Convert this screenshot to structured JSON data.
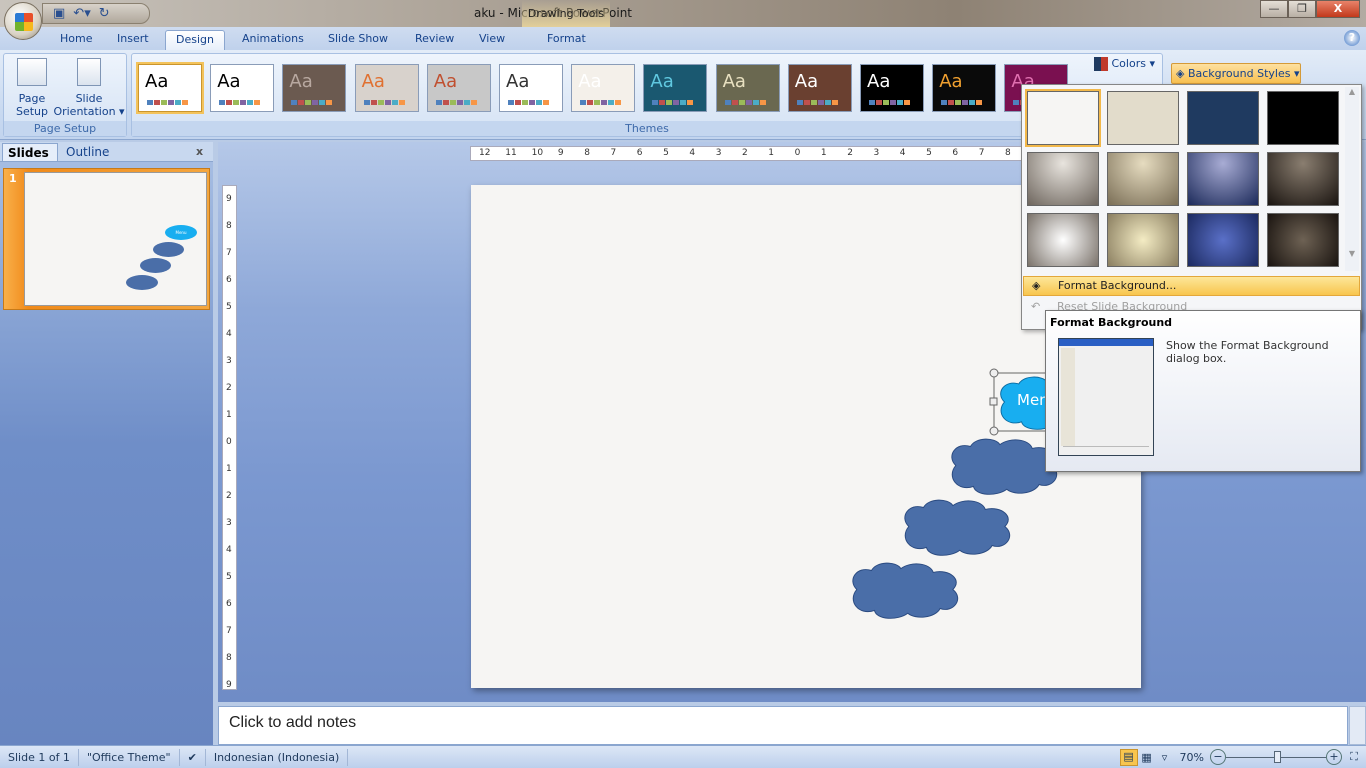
{
  "window": {
    "title": "aku - Microsoft PowerPoint",
    "context_tab_group": "Drawing Tools",
    "minimize": "—",
    "restore": "❐",
    "close": "X"
  },
  "qat": {
    "save_icon": "save-icon",
    "undo_icon": "undo-icon",
    "redo_icon": "redo-icon"
  },
  "tabs": [
    {
      "label": "Home"
    },
    {
      "label": "Insert"
    },
    {
      "label": "Design",
      "active": true
    },
    {
      "label": "Animations"
    },
    {
      "label": "Slide Show"
    },
    {
      "label": "Review"
    },
    {
      "label": "View"
    },
    {
      "label": "Format"
    }
  ],
  "ribbon": {
    "page_setup": {
      "label": "Page Setup",
      "page_setup_l1": "Page",
      "page_setup_l2": "Setup",
      "orient_l1": "Slide",
      "orient_l2": "Orientation ▾"
    },
    "themes": {
      "label": "Themes",
      "items": [
        {
          "bg": "#ffffff",
          "fg": "#000000"
        },
        {
          "bg": "#ffffff",
          "fg": "#000000"
        },
        {
          "bg": "#6b5a50",
          "fg": "#b8a8a0"
        },
        {
          "bg": "#d8d2cc",
          "fg": "#e07030"
        },
        {
          "bg": "#c8c8c8",
          "fg": "#c05030"
        },
        {
          "bg": "#ffffff",
          "fg": "#333333"
        },
        {
          "bg": "#f4f0ea",
          "fg": "#ffffff"
        },
        {
          "bg": "#1a5870",
          "fg": "#60c8e0"
        },
        {
          "bg": "#6a6850",
          "fg": "#e8e0c0"
        },
        {
          "bg": "#6a4030",
          "fg": "#ffffff"
        },
        {
          "bg": "#000000",
          "fg": "#ffffff"
        },
        {
          "bg": "#0a0a0a",
          "fg": "#f0a030"
        },
        {
          "bg": "#7a1050",
          "fg": "#e070b0"
        }
      ],
      "sample": "Aa"
    },
    "colors_label": "Colors ▾",
    "background_styles_label": "Background Styles ▾"
  },
  "background_gallery": {
    "styles": [
      {
        "fill": "#f6f5f3"
      },
      {
        "fill": "#e2dccb"
      },
      {
        "fill": "#1f3a60"
      },
      {
        "fill": "#000000"
      },
      {
        "fill": "radial-gradient(circle at 50% 20%,#e8e4de,#6e665e)"
      },
      {
        "fill": "radial-gradient(circle at 50% 20%,#e6dcc0,#7a6e56)"
      },
      {
        "fill": "radial-gradient(circle at 50% 20%,#a8acd4,#1c2a5a)"
      },
      {
        "fill": "radial-gradient(circle at 50% 20%,#8a7e70,#1a1410)"
      },
      {
        "fill": "radial-gradient(circle,#ffffff,#7a726a)"
      },
      {
        "fill": "radial-gradient(circle,#f4ecc4,#8a7e60)"
      },
      {
        "fill": "radial-gradient(circle,#5a70c8,#1c2a60)"
      },
      {
        "fill": "radial-gradient(circle,#6e6254,#1a1410)"
      }
    ],
    "format_background": "Format Background...",
    "reset_slide_background": "Reset Slide Background"
  },
  "tooltip": {
    "title": "Format Background",
    "description": "Show the Format Background dialog box."
  },
  "left_pane": {
    "tabs": [
      "Slides",
      "Outline"
    ],
    "close": "x",
    "slide_number": "1"
  },
  "rulers": {
    "horizontal": [
      "12",
      "11",
      "10",
      "9",
      "8",
      "7",
      "6",
      "5",
      "4",
      "3",
      "2",
      "1",
      "0",
      "1",
      "2",
      "3",
      "4",
      "5",
      "6",
      "7",
      "8"
    ],
    "vertical": [
      "9",
      "8",
      "7",
      "6",
      "5",
      "4",
      "3",
      "2",
      "1",
      "0",
      "1",
      "2",
      "3",
      "4",
      "5",
      "6",
      "7",
      "8",
      "9"
    ]
  },
  "slide": {
    "selected_shape_text": "Menu",
    "thumb_shape_text": "Menu"
  },
  "notes": {
    "placeholder": "Click to add notes"
  },
  "status": {
    "slide": "Slide 1 of 1",
    "theme": "\"Office Theme\"",
    "language": "Indonesian (Indonesia)",
    "zoom": "70%",
    "zoom_level_percent": 70
  },
  "colors": {
    "cloud": "#4a6ea8",
    "cloud_selected": "#18aef0",
    "accent": "#f8c54e"
  }
}
